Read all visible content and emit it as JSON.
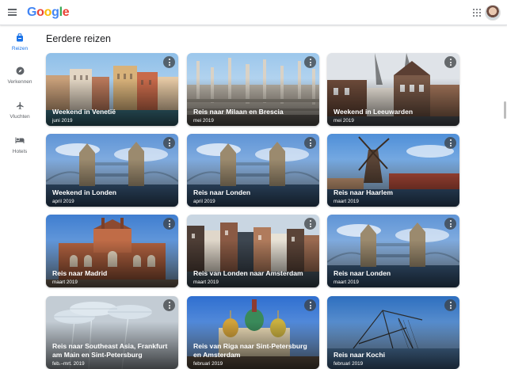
{
  "header": {
    "logo_text": "Google",
    "menu_icon": "hamburger-menu-icon",
    "apps_icon": "apps-grid-icon",
    "avatar_icon": "account-avatar"
  },
  "sidebar": {
    "items": [
      {
        "label": "Reizen",
        "icon": "trips-bag-icon",
        "active": true
      },
      {
        "label": "Verkennen",
        "icon": "explore-compass-icon",
        "active": false
      },
      {
        "label": "Vluchten",
        "icon": "flight-plane-icon",
        "active": false
      },
      {
        "label": "Hotels",
        "icon": "hotel-bed-icon",
        "active": false
      }
    ]
  },
  "main": {
    "title": "Eerdere reizen",
    "trips": [
      {
        "title": "Weekend in Venetië",
        "date": "juni 2019",
        "scene": "venice"
      },
      {
        "title": "Reis naar Milaan en Brescia",
        "date": "mei 2019",
        "scene": "milan"
      },
      {
        "title": "Weekend in Leeuwarden",
        "date": "mei 2019",
        "scene": "leeuwarden"
      },
      {
        "title": "Weekend in Londen",
        "date": "april 2019",
        "scene": "london"
      },
      {
        "title": "Reis naar Londen",
        "date": "april 2019",
        "scene": "london"
      },
      {
        "title": "Reis naar Haarlem",
        "date": "maart 2019",
        "scene": "haarlem"
      },
      {
        "title": "Reis naar Madrid",
        "date": "maart 2019",
        "scene": "madrid"
      },
      {
        "title": "Reis van Londen naar Amsterdam",
        "date": "maart 2019",
        "scene": "amsterdam"
      },
      {
        "title": "Reis naar Londen",
        "date": "maart 2019",
        "scene": "london"
      },
      {
        "title": "Reis naar Southeast Asia, Frankfurt am Main en Sint-Petersburg",
        "date": "feb.–mrt. 2019",
        "scene": "singapore"
      },
      {
        "title": "Reis van Riga naar Sint-Petersburg en Amsterdam",
        "date": "februari 2019",
        "scene": "petersburg"
      },
      {
        "title": "Reis naar Kochi",
        "date": "februari 2019",
        "scene": "kochi"
      }
    ]
  },
  "colors": {
    "accent": "#1a73e8",
    "text_secondary": "#5f6368"
  }
}
